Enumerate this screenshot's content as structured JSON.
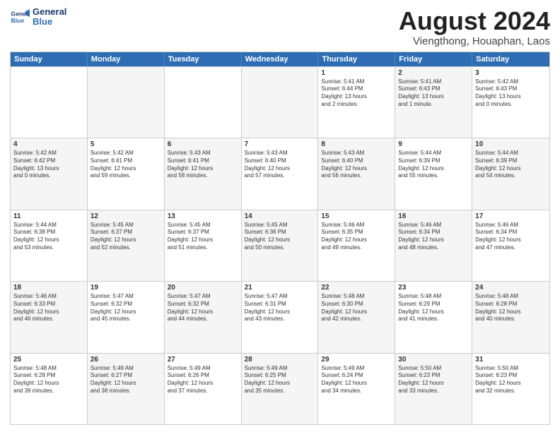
{
  "logo": {
    "line1": "General",
    "line2": "Blue"
  },
  "title": "August 2024",
  "subtitle": "Viengthong, Houaphan, Laos",
  "days": [
    "Sunday",
    "Monday",
    "Tuesday",
    "Wednesday",
    "Thursday",
    "Friday",
    "Saturday"
  ],
  "rows": [
    [
      {
        "day": "",
        "text": "",
        "shade": "white"
      },
      {
        "day": "",
        "text": "",
        "shade": "shaded"
      },
      {
        "day": "",
        "text": "",
        "shade": "white"
      },
      {
        "day": "",
        "text": "",
        "shade": "shaded"
      },
      {
        "day": "1",
        "text": "Sunrise: 5:41 AM\nSunset: 6:44 PM\nDaylight: 13 hours\nand 2 minutes.",
        "shade": "white"
      },
      {
        "day": "2",
        "text": "Sunrise: 5:41 AM\nSunset: 6:43 PM\nDaylight: 13 hours\nand 1 minute.",
        "shade": "shaded"
      },
      {
        "day": "3",
        "text": "Sunrise: 5:42 AM\nSunset: 6:43 PM\nDaylight: 13 hours\nand 0 minutes.",
        "shade": "white"
      }
    ],
    [
      {
        "day": "4",
        "text": "Sunrise: 5:42 AM\nSunset: 6:42 PM\nDaylight: 13 hours\nand 0 minutes.",
        "shade": "shaded"
      },
      {
        "day": "5",
        "text": "Sunrise: 5:42 AM\nSunset: 6:41 PM\nDaylight: 12 hours\nand 59 minutes.",
        "shade": "white"
      },
      {
        "day": "6",
        "text": "Sunrise: 5:43 AM\nSunset: 6:41 PM\nDaylight: 12 hours\nand 58 minutes.",
        "shade": "shaded"
      },
      {
        "day": "7",
        "text": "Sunrise: 5:43 AM\nSunset: 6:40 PM\nDaylight: 12 hours\nand 57 minutes.",
        "shade": "white"
      },
      {
        "day": "8",
        "text": "Sunrise: 5:43 AM\nSunset: 6:40 PM\nDaylight: 12 hours\nand 56 minutes.",
        "shade": "shaded"
      },
      {
        "day": "9",
        "text": "Sunrise: 5:44 AM\nSunset: 6:39 PM\nDaylight: 12 hours\nand 55 minutes.",
        "shade": "white"
      },
      {
        "day": "10",
        "text": "Sunrise: 5:44 AM\nSunset: 6:39 PM\nDaylight: 12 hours\nand 54 minutes.",
        "shade": "shaded"
      }
    ],
    [
      {
        "day": "11",
        "text": "Sunrise: 5:44 AM\nSunset: 6:38 PM\nDaylight: 12 hours\nand 53 minutes.",
        "shade": "white"
      },
      {
        "day": "12",
        "text": "Sunrise: 5:45 AM\nSunset: 6:37 PM\nDaylight: 12 hours\nand 52 minutes.",
        "shade": "shaded"
      },
      {
        "day": "13",
        "text": "Sunrise: 5:45 AM\nSunset: 6:37 PM\nDaylight: 12 hours\nand 51 minutes.",
        "shade": "white"
      },
      {
        "day": "14",
        "text": "Sunrise: 5:45 AM\nSunset: 6:36 PM\nDaylight: 12 hours\nand 50 minutes.",
        "shade": "shaded"
      },
      {
        "day": "15",
        "text": "Sunrise: 5:46 AM\nSunset: 6:35 PM\nDaylight: 12 hours\nand 49 minutes.",
        "shade": "white"
      },
      {
        "day": "16",
        "text": "Sunrise: 5:46 AM\nSunset: 6:34 PM\nDaylight: 12 hours\nand 48 minutes.",
        "shade": "shaded"
      },
      {
        "day": "17",
        "text": "Sunrise: 5:46 AM\nSunset: 6:34 PM\nDaylight: 12 hours\nand 47 minutes.",
        "shade": "white"
      }
    ],
    [
      {
        "day": "18",
        "text": "Sunrise: 5:46 AM\nSunset: 6:33 PM\nDaylight: 12 hours\nand 46 minutes.",
        "shade": "shaded"
      },
      {
        "day": "19",
        "text": "Sunrise: 5:47 AM\nSunset: 6:32 PM\nDaylight: 12 hours\nand 45 minutes.",
        "shade": "white"
      },
      {
        "day": "20",
        "text": "Sunrise: 5:47 AM\nSunset: 6:32 PM\nDaylight: 12 hours\nand 44 minutes.",
        "shade": "shaded"
      },
      {
        "day": "21",
        "text": "Sunrise: 5:47 AM\nSunset: 6:31 PM\nDaylight: 12 hours\nand 43 minutes.",
        "shade": "white"
      },
      {
        "day": "22",
        "text": "Sunrise: 5:48 AM\nSunset: 6:30 PM\nDaylight: 12 hours\nand 42 minutes.",
        "shade": "shaded"
      },
      {
        "day": "23",
        "text": "Sunrise: 5:48 AM\nSunset: 6:29 PM\nDaylight: 12 hours\nand 41 minutes.",
        "shade": "white"
      },
      {
        "day": "24",
        "text": "Sunrise: 5:48 AM\nSunset: 6:28 PM\nDaylight: 12 hours\nand 40 minutes.",
        "shade": "shaded"
      }
    ],
    [
      {
        "day": "25",
        "text": "Sunrise: 5:48 AM\nSunset: 6:28 PM\nDaylight: 12 hours\nand 39 minutes.",
        "shade": "white"
      },
      {
        "day": "26",
        "text": "Sunrise: 5:49 AM\nSunset: 6:27 PM\nDaylight: 12 hours\nand 38 minutes.",
        "shade": "shaded"
      },
      {
        "day": "27",
        "text": "Sunrise: 5:49 AM\nSunset: 6:26 PM\nDaylight: 12 hours\nand 37 minutes.",
        "shade": "white"
      },
      {
        "day": "28",
        "text": "Sunrise: 5:49 AM\nSunset: 6:25 PM\nDaylight: 12 hours\nand 35 minutes.",
        "shade": "shaded"
      },
      {
        "day": "29",
        "text": "Sunrise: 5:49 AM\nSunset: 6:24 PM\nDaylight: 12 hours\nand 34 minutes.",
        "shade": "white"
      },
      {
        "day": "30",
        "text": "Sunrise: 5:50 AM\nSunset: 6:23 PM\nDaylight: 12 hours\nand 33 minutes.",
        "shade": "shaded"
      },
      {
        "day": "31",
        "text": "Sunrise: 5:50 AM\nSunset: 6:23 PM\nDaylight: 12 hours\nand 32 minutes.",
        "shade": "white"
      }
    ]
  ]
}
